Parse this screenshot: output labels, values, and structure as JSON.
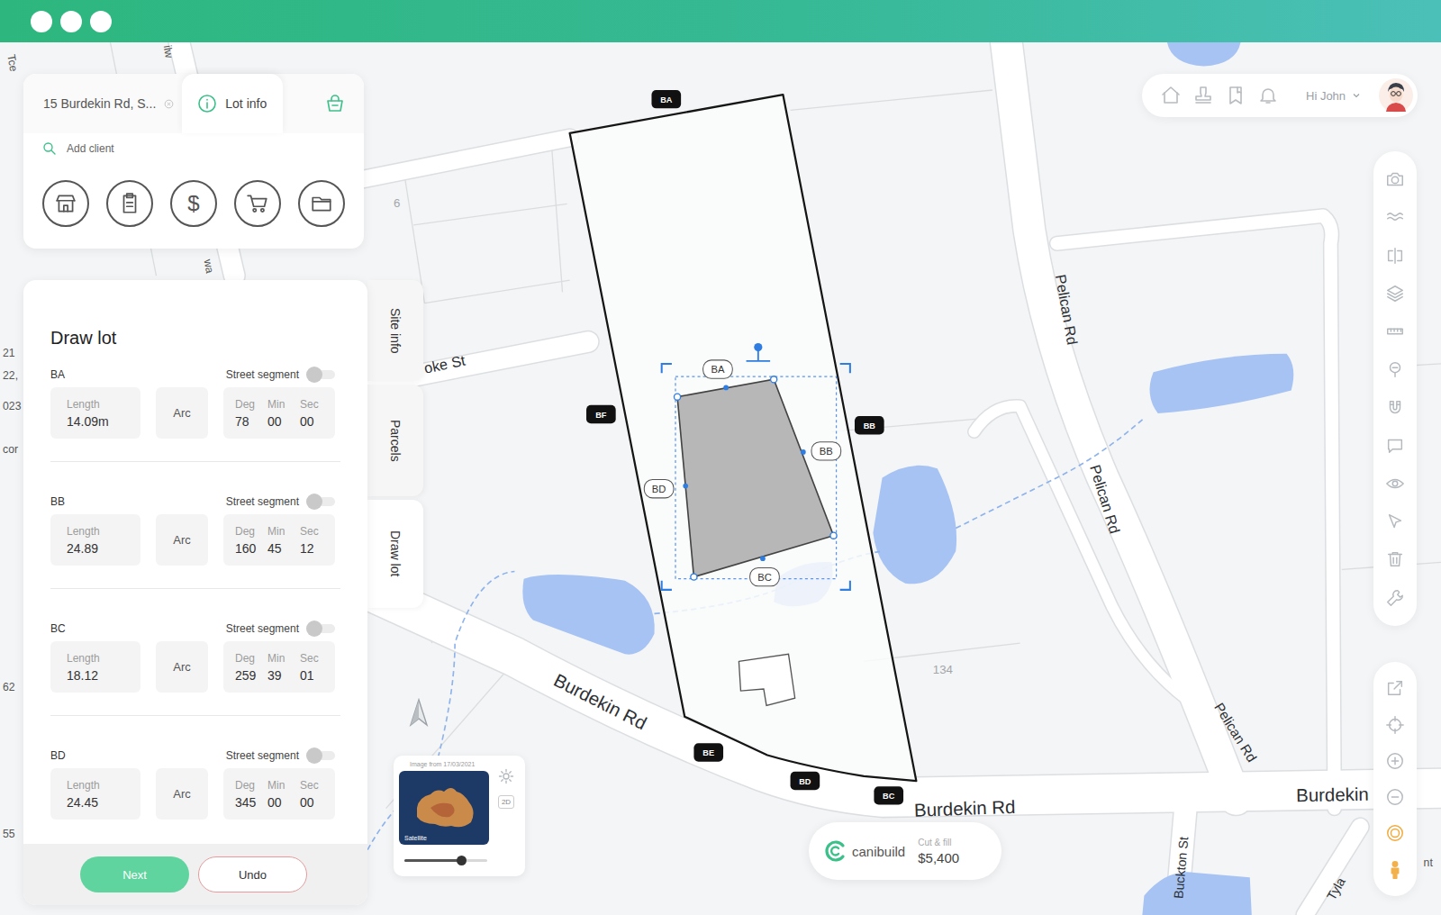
{
  "location_tabs": [
    {
      "label": "15 Burdekin Rd, S...",
      "kind": "address",
      "selected": false
    },
    {
      "label": "Lot info",
      "kind": "info",
      "selected": true
    }
  ],
  "search": {
    "placeholder": "Add client"
  },
  "quick_actions": {
    "price_symbol": "$"
  },
  "side_tabs": [
    {
      "label": "Site info",
      "selected": false
    },
    {
      "label": "Parcels",
      "selected": false
    },
    {
      "label": "Draw lot",
      "selected": true
    }
  ],
  "draw_lot": {
    "title": "Draw lot",
    "street_segment_label": "Street segment",
    "length_label": "Length",
    "arc_label": "Arc",
    "angle_labels": [
      "Deg",
      "Min",
      "Sec"
    ],
    "segments": [
      {
        "name": "BA",
        "street_segment": false,
        "length": "14.09m",
        "deg": "78",
        "min": "00",
        "sec": "00"
      },
      {
        "name": "BB",
        "street_segment": false,
        "length": "24.89",
        "deg": "160",
        "min": "45",
        "sec": "12"
      },
      {
        "name": "BC",
        "street_segment": false,
        "length": "18.12",
        "deg": "259",
        "min": "39",
        "sec": "01"
      },
      {
        "name": "BD",
        "street_segment": false,
        "length": "24.45",
        "deg": "345",
        "min": "00",
        "sec": "00"
      }
    ]
  },
  "actions": [
    {
      "label": "Next",
      "kind": "primary"
    },
    {
      "label": "Undo",
      "kind": "secondary"
    }
  ],
  "user": {
    "greeting": "Hi John"
  },
  "estimate": {
    "brand": "canibuild",
    "label": "Cut & fill",
    "value": "$5,400"
  },
  "minimap": {
    "caption": "Image from 17/03/2021",
    "label": "Satellite",
    "view_mode": "2D",
    "level": 0.68
  },
  "map": {
    "streets": [
      "Burdekin Rd",
      "Burdekin Rd",
      "Burdekin",
      "Pelican Rd",
      "Pelican Rd",
      "Pelican Rd",
      "Buckton St",
      "oke St",
      "Tyla"
    ],
    "lot_numbers": [
      "6",
      "134"
    ],
    "edge_labels": [
      "Tce",
      "ilw",
      "wa",
      "21",
      "22,",
      "023",
      "cor",
      "62",
      "55",
      "nt"
    ],
    "lot_corners": [
      "BA",
      "BB",
      "BC",
      "BD",
      "BE",
      "BF"
    ],
    "building_edges": [
      "BA",
      "BB",
      "BC",
      "BD"
    ]
  }
}
